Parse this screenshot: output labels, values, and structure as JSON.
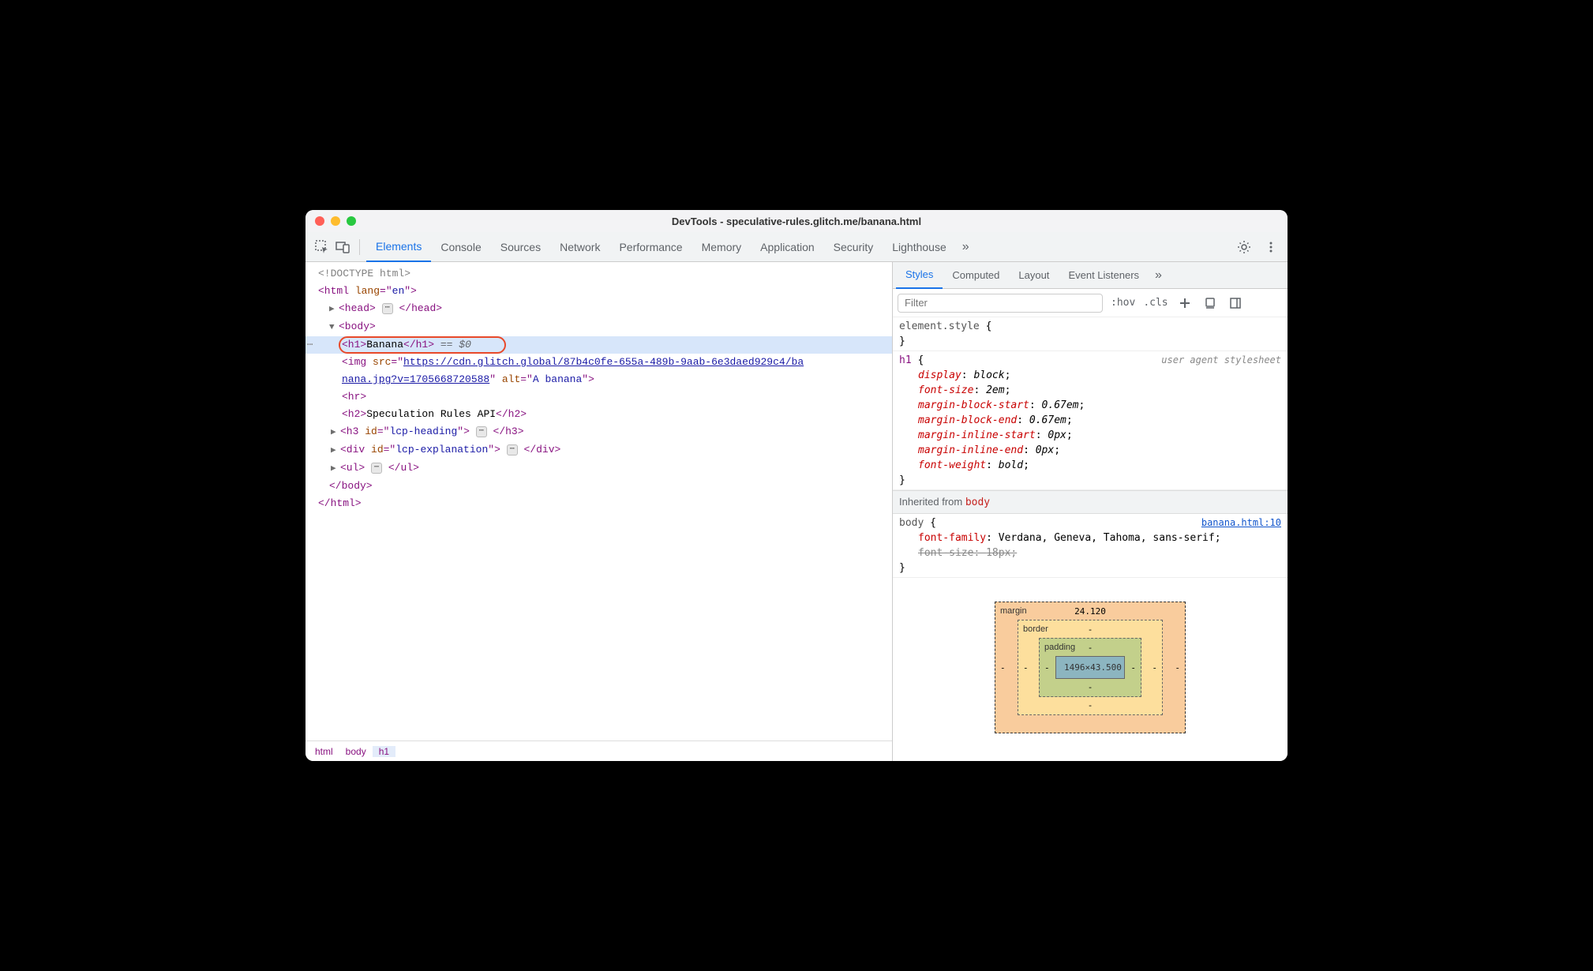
{
  "window": {
    "title": "DevTools - speculative-rules.glitch.me/banana.html"
  },
  "toolbar": {
    "tabs": [
      "Elements",
      "Console",
      "Sources",
      "Network",
      "Performance",
      "Memory",
      "Application",
      "Security",
      "Lighthouse"
    ],
    "active_tab_index": 0
  },
  "dom": {
    "doctype": "<!DOCTYPE html>",
    "html_open": "<html lang=\"en\">",
    "head_open": "<head>",
    "head_close": "</head>",
    "body_open": "<body>",
    "selected_line": {
      "open_tag": "<h1>",
      "text": "Banana",
      "close_tag": "</h1>",
      "ref": "== $0"
    },
    "img_line": {
      "prefix": "<img src=\"",
      "url_part1": "https://cdn.glitch.global/87b4c0fe-655a-489b-9aab-6e3daed929c4/ba",
      "url_part2": "nana.jpg?v=1705668720588",
      "suffix": "\" alt=\"A banana\">"
    },
    "hr": "<hr>",
    "h2_open": "<h2>",
    "h2_text": "Speculation Rules API",
    "h2_close": "</h2>",
    "h3": "<h3 id=\"lcp-heading\">",
    "h3_close": "</h3>",
    "div": "<div id=\"lcp-explanation\">",
    "div_close": "</div>",
    "ul": "<ul>",
    "ul_close": "</ul>",
    "body_close": "</body>",
    "html_close": "</html>"
  },
  "breadcrumbs": [
    "html",
    "body",
    "h1"
  ],
  "styles_panel": {
    "tabs": [
      "Styles",
      "Computed",
      "Layout",
      "Event Listeners"
    ],
    "active_index": 0,
    "filter_placeholder": "Filter",
    "hov": ":hov",
    "cls": ".cls"
  },
  "css": {
    "element_style": {
      "selector": "element.style",
      "open": " {",
      "close": "}"
    },
    "h1_rule": {
      "selector": "h1",
      "ua_note": "user agent stylesheet",
      "props": [
        {
          "name": "display",
          "value": "block"
        },
        {
          "name": "font-size",
          "value": "2em"
        },
        {
          "name": "margin-block-start",
          "value": "0.67em"
        },
        {
          "name": "margin-block-end",
          "value": "0.67em"
        },
        {
          "name": "margin-inline-start",
          "value": "0px"
        },
        {
          "name": "margin-inline-end",
          "value": "0px"
        },
        {
          "name": "font-weight",
          "value": "bold"
        }
      ]
    },
    "inherited_label": "Inherited from ",
    "inherited_from": "body",
    "body_rule": {
      "selector": "body",
      "src": "banana.html:10",
      "props": [
        {
          "name": "font-family",
          "value": "Verdana, Geneva, Tahoma, sans-serif",
          "struck": false
        },
        {
          "name": "font-size",
          "value": "18px",
          "struck": true
        }
      ]
    }
  },
  "box_model": {
    "margin_label": "margin",
    "margin_top": "24.120",
    "border_label": "border",
    "border_top": "-",
    "padding_label": "padding",
    "padding_top": "-",
    "content": "1496×43.500",
    "dash": "-"
  }
}
